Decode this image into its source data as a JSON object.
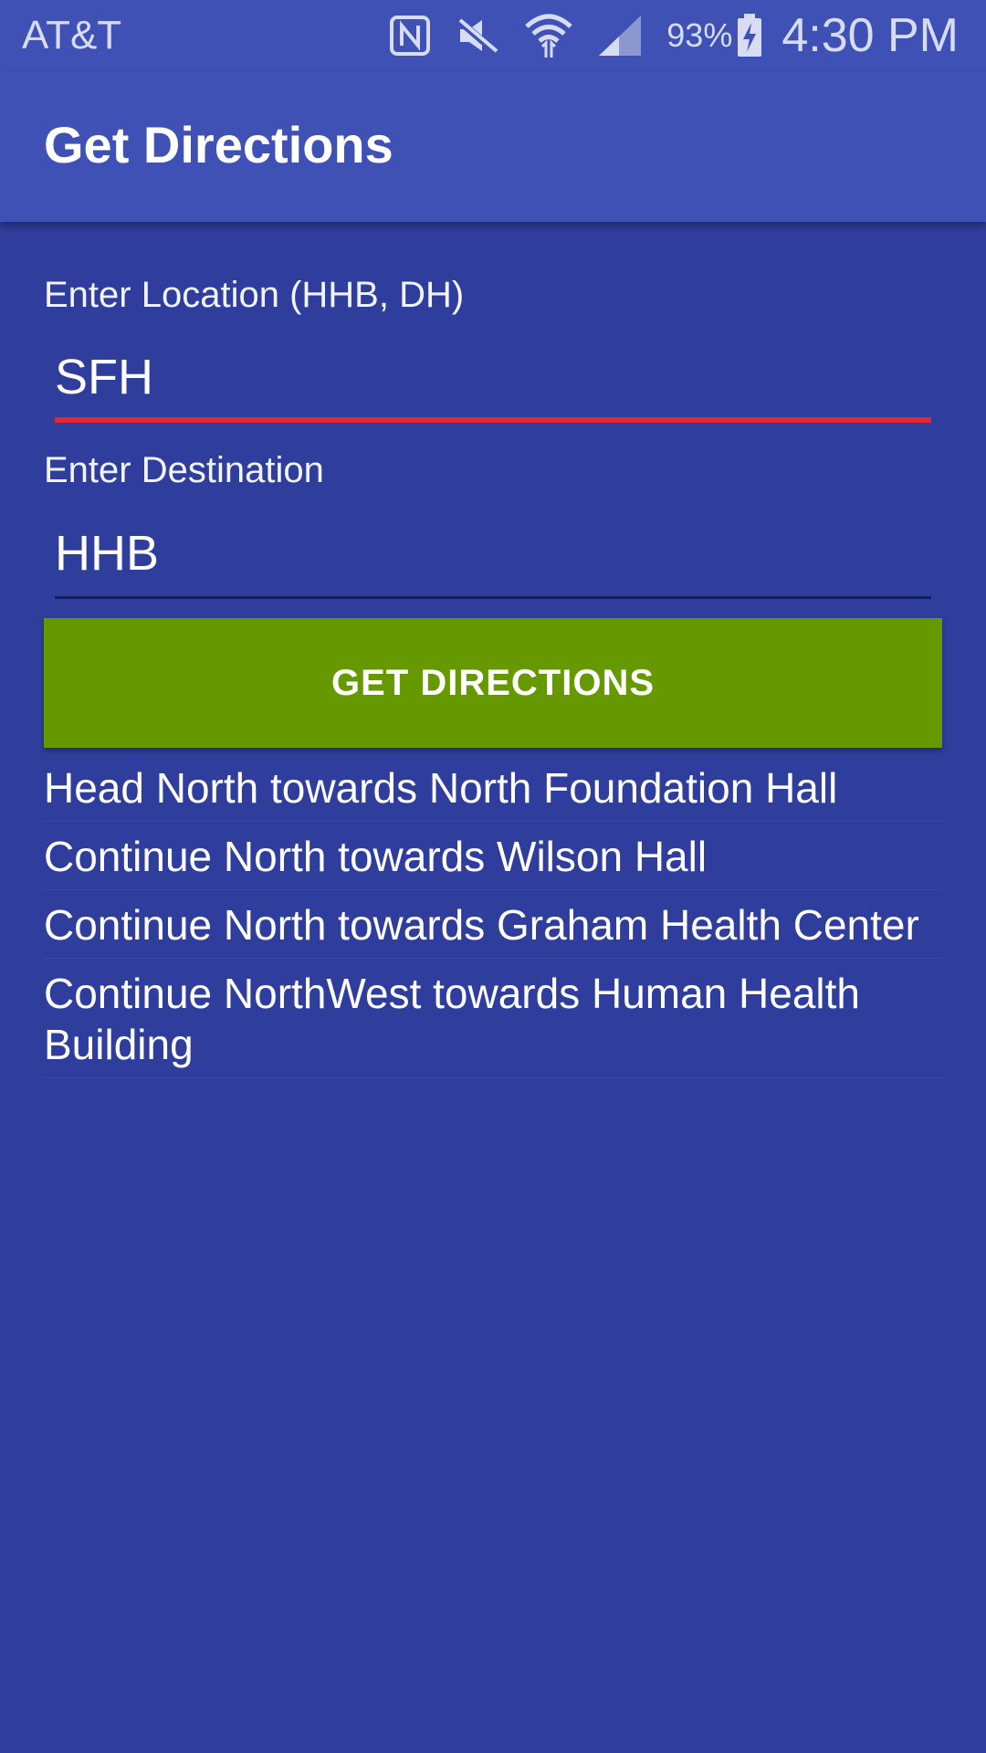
{
  "status_bar": {
    "carrier": "AT&T",
    "battery": "93%",
    "time": "4:30 PM",
    "icons": [
      "nfc-icon",
      "mute-icon",
      "wifi-icon",
      "signal-icon",
      "battery-charging-icon"
    ]
  },
  "app_bar": {
    "title": "Get Directions"
  },
  "form": {
    "location_label": "Enter Location (HHB, DH)",
    "location_value": "SFH",
    "destination_label": "Enter Destination",
    "destination_value": "HHB",
    "button_label": "GET DIRECTIONS"
  },
  "directions": [
    "Head North towards North Foundation Hall",
    "Continue North towards Wilson Hall",
    "Continue North towards Graham Health Center",
    "Continue NorthWest towards Human Health Building"
  ],
  "colors": {
    "primary": "#3f51b5",
    "background": "#2f3d9c",
    "button": "#669900",
    "error_underline": "#e8242d"
  }
}
